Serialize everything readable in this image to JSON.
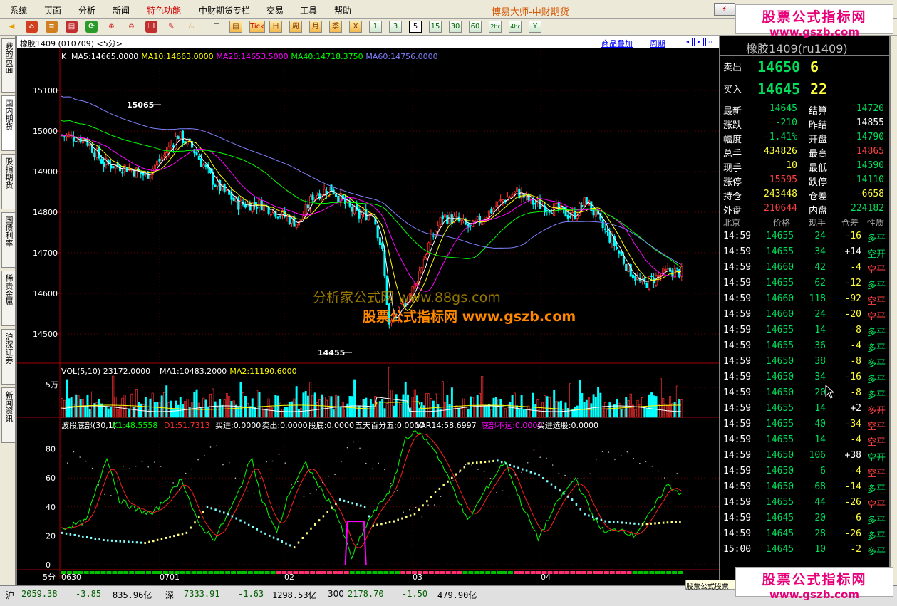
{
  "menu": [
    "系统",
    "页面",
    "分析",
    "新闻",
    "特色功能",
    "中财期货专栏",
    "交易",
    "工具",
    "帮助"
  ],
  "app_title": "博易大师-中财期货",
  "toolbar": {
    "periods": [
      "1",
      "3",
      "5",
      "15",
      "30",
      "60",
      "2hr",
      "4hr",
      "Y"
    ],
    "cal": [
      "Tick",
      "日",
      "周",
      "月",
      "季",
      "X"
    ],
    "selected_period": "5"
  },
  "left_tabs": [
    "我的页面",
    "国内期货",
    "股指期货",
    "国债利率",
    "稀贵金属",
    "沪深证券",
    "新闻资讯"
  ],
  "chart": {
    "header": "橡胶1409 (010709) <5分>",
    "link_overlay": "商品叠加",
    "link_period": "周期",
    "ma_label_k": "K",
    "ma_labels": [
      {
        "text": "MA5:14665.0000",
        "color": "#ffffff"
      },
      {
        "text": "MA10:14663.0000",
        "color": "#ffff00"
      },
      {
        "text": "MA20:14653.5000",
        "color": "#ff00ff"
      },
      {
        "text": "MA40:14718.3750",
        "color": "#00ff00"
      },
      {
        "text": "MA60:14756.0000",
        "color": "#8080ff"
      }
    ],
    "vol_labels": [
      {
        "text": "VOL(5,10) 23172.0000",
        "color": "#ffffff"
      },
      {
        "text": "MA1:10483.2000",
        "color": "#ffffff"
      },
      {
        "text": "MA2:11190.6000",
        "color": "#ffff00"
      }
    ],
    "ind_labels": [
      {
        "text": "波段底部(30,1)",
        "color": "#ffffff"
      },
      {
        "text": "K1:48.5558",
        "color": "#00ff00"
      },
      {
        "text": "D1:51.7313",
        "color": "#ff3030"
      },
      {
        "text": "买进:0.0000",
        "color": "#ffffff"
      },
      {
        "text": "卖出:0.0000",
        "color": "#ffffff"
      },
      {
        "text": "段底:0.0000",
        "color": "#ffffff"
      },
      {
        "text": "五天百分五:0.0000",
        "color": "#ffffff"
      },
      {
        "text": "VAR14:58.6997",
        "color": "#ffffff"
      },
      {
        "text": "底部不远:0.0000",
        "color": "#ff00ff"
      },
      {
        "text": "买进选股:0.0000",
        "color": "#ffffff"
      }
    ],
    "price_ticks": [
      "15100",
      "15000",
      "14900",
      "14800",
      "14700",
      "14600",
      "14500"
    ],
    "vol_tick": "5万",
    "ind_ticks": [
      "80",
      "60",
      "40",
      "20",
      "0"
    ],
    "high_label": "15065",
    "low_label": "14455",
    "date_ticks": [
      "0630",
      "0701",
      "02",
      "03",
      "04"
    ],
    "period_label": "5分",
    "watermark_center": "分析家公式网 www.88gs.com",
    "watermark_center2": "股票公式指标网 www.gszb.com"
  },
  "quote": {
    "title": "橡胶1409(ru1409)",
    "ask": {
      "label": "卖出",
      "price": "14650",
      "vol": "6"
    },
    "bid": {
      "label": "买入",
      "price": "14645",
      "vol": "22"
    },
    "fields": [
      {
        "l1": "最新",
        "v1": "14645",
        "c1": "g",
        "l2": "结算",
        "v2": "14720",
        "c2": "g"
      },
      {
        "l1": "涨跌",
        "v1": "-210",
        "c1": "g",
        "l2": "昨结",
        "v2": "14855",
        "c2": "w"
      },
      {
        "l1": "幅度",
        "v1": "-1.41%",
        "c1": "g",
        "l2": "开盘",
        "v2": "14790",
        "c2": "g"
      },
      {
        "l1": "总手",
        "v1": "434826",
        "c1": "y",
        "l2": "最高",
        "v2": "14865",
        "c2": "r"
      },
      {
        "l1": "现手",
        "v1": "10",
        "c1": "y",
        "l2": "最低",
        "v2": "14590",
        "c2": "g"
      },
      {
        "l1": "涨停",
        "v1": "15595",
        "c1": "r",
        "l2": "跌停",
        "v2": "14110",
        "c2": "g"
      },
      {
        "l1": "持仓",
        "v1": "243448",
        "c1": "y",
        "l2": "仓差",
        "v2": "-6658",
        "c2": "y"
      },
      {
        "l1": "外盘",
        "v1": "210644",
        "c1": "r",
        "l2": "内盘",
        "v2": "224182",
        "c2": "g"
      }
    ],
    "tick_headers": [
      "北京",
      "价格",
      "现手",
      "仓差",
      "性质"
    ],
    "ticks": [
      {
        "t": "14:59",
        "p": "14655",
        "v": "24",
        "d": "-16",
        "n": "多平",
        "nc": "g"
      },
      {
        "t": "14:59",
        "p": "14655",
        "v": "34",
        "d": "+14",
        "n": "空开",
        "nc": "g"
      },
      {
        "t": "14:59",
        "p": "14660",
        "v": "42",
        "d": "-4",
        "n": "空平",
        "nc": "r"
      },
      {
        "t": "14:59",
        "p": "14655",
        "v": "62",
        "d": "-12",
        "n": "多平",
        "nc": "g"
      },
      {
        "t": "14:59",
        "p": "14660",
        "v": "118",
        "d": "-92",
        "n": "空平",
        "nc": "r"
      },
      {
        "t": "14:59",
        "p": "14660",
        "v": "24",
        "d": "-20",
        "n": "空平",
        "nc": "r"
      },
      {
        "t": "14:59",
        "p": "14655",
        "v": "14",
        "d": "-8",
        "n": "多平",
        "nc": "g"
      },
      {
        "t": "14:59",
        "p": "14655",
        "v": "36",
        "d": "-4",
        "n": "多平",
        "nc": "g"
      },
      {
        "t": "14:59",
        "p": "14650",
        "v": "38",
        "d": "-8",
        "n": "多平",
        "nc": "g"
      },
      {
        "t": "14:59",
        "p": "14650",
        "v": "34",
        "d": "-16",
        "n": "多平",
        "nc": "g"
      },
      {
        "t": "14:59",
        "p": "14650",
        "v": "20",
        "d": "-8",
        "n": "多平",
        "nc": "g"
      },
      {
        "t": "14:59",
        "p": "14655",
        "v": "14",
        "d": "+2",
        "n": "多开",
        "nc": "r"
      },
      {
        "t": "14:59",
        "p": "14655",
        "v": "40",
        "d": "-34",
        "n": "空平",
        "nc": "r"
      },
      {
        "t": "14:59",
        "p": "14655",
        "v": "14",
        "d": "-4",
        "n": "空平",
        "nc": "r"
      },
      {
        "t": "14:59",
        "p": "14650",
        "v": "106",
        "d": "+38",
        "n": "空开",
        "nc": "g"
      },
      {
        "t": "14:59",
        "p": "14650",
        "v": "6",
        "d": "-4",
        "n": "空平",
        "nc": "r"
      },
      {
        "t": "14:59",
        "p": "14650",
        "v": "68",
        "d": "-14",
        "n": "多平",
        "nc": "g"
      },
      {
        "t": "14:59",
        "p": "14655",
        "v": "44",
        "d": "-26",
        "n": "空平",
        "nc": "r"
      },
      {
        "t": "14:59",
        "p": "14645",
        "v": "20",
        "d": "-6",
        "n": "多平",
        "nc": "g"
      },
      {
        "t": "14:59",
        "p": "14645",
        "v": "28",
        "d": "-26",
        "n": "多平",
        "nc": "g"
      },
      {
        "t": "15:00",
        "p": "14645",
        "v": "10",
        "d": "-2",
        "n": "多平",
        "nc": "g"
      }
    ]
  },
  "status": {
    "sh_label": "沪",
    "sh_index": "2059.38",
    "sh_chg": "-3.85",
    "sh_amt": "835.96亿",
    "sz_label": "深",
    "sz_index": "7333.91",
    "sz_chg": "-1.63",
    "sz_amt": "1298.53亿",
    "hs_label": "300",
    "hs_index": "2178.70",
    "hs_chg": "-1.50",
    "hs_amt": "479.90亿"
  },
  "watermark": {
    "line1": "股票公式指标网",
    "line2": "www.gszb.com",
    "small": "股票公式股票"
  }
}
